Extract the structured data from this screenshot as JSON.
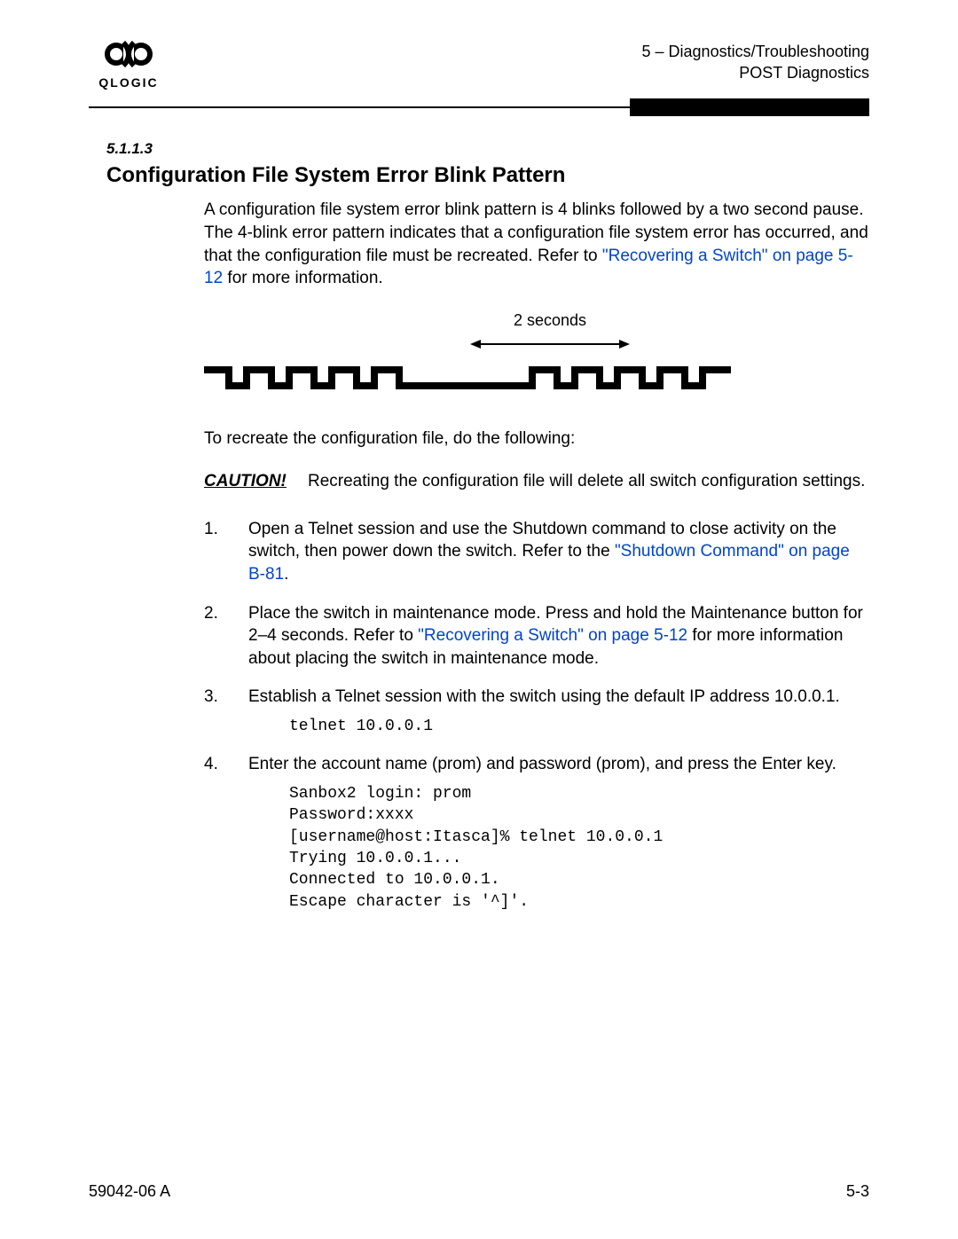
{
  "header": {
    "logo_text": "QLOGIC",
    "chapter": "5 – Diagnostics/Troubleshooting",
    "section": "POST Diagnostics"
  },
  "section_number": "5.1.1.3",
  "title": "Configuration File System Error Blink Pattern",
  "intro": {
    "part1": "A configuration file system error blink pattern is 4 blinks followed by a two second pause. The 4-blink error pattern indicates that a configuration file system error has occurred, and that the configuration file must be recreated. Refer to ",
    "link1": "\"Recovering a Switch\" on page 5-12",
    "part2": " for more information."
  },
  "diagram_label": "2 seconds",
  "recreate_intro": "To recreate the configuration file, do the following:",
  "caution": {
    "label": "CAUTION!",
    "text": "Recreating the configuration file will delete all switch configuration settings."
  },
  "steps": [
    {
      "text_a": "Open a Telnet session and use the Shutdown command to close activity on the switch, then power down the switch. Refer to the ",
      "link": "\"Shutdown Command\" on page B-81",
      "text_b": "."
    },
    {
      "text_a": "Place the switch in maintenance mode. Press and hold the Maintenance button for 2–4 seconds. Refer to ",
      "link": "\"Recovering a Switch\" on page 5-12",
      "text_b": " for more information about placing the switch in maintenance mode."
    },
    {
      "text_a": "Establish a Telnet session with the switch using the default IP address 10.0.0.1.",
      "link": "",
      "text_b": "",
      "code": "telnet 10.0.0.1"
    },
    {
      "text_a": "Enter the account name (prom) and password (prom), and press the Enter key.",
      "link": "",
      "text_b": "",
      "code": "Sanbox2 login: prom\nPassword:xxxx\n[username@host:Itasca]% telnet 10.0.0.1\nTrying 10.0.0.1...\nConnected to 10.0.0.1.\nEscape character is '^]'."
    }
  ],
  "footer": {
    "left": "59042-06  A",
    "right": "5-3"
  }
}
